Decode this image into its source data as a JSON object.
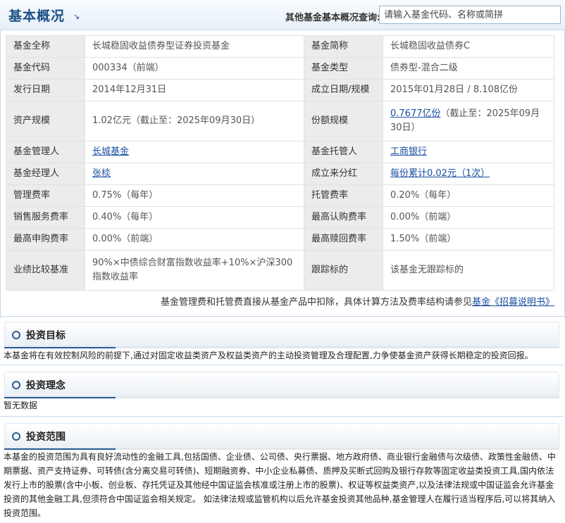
{
  "header": {
    "title": "基本概况",
    "title_arrow": "↘",
    "query_label": "其他基金基本概况查询:",
    "search_placeholder": "请输入基金代码、名称或简拼"
  },
  "info_rows": [
    {
      "label1": "基金全称",
      "value1": "长城稳固收益债券型证券投资基金",
      "label2": "基金简称",
      "value2": "长城稳固收益债券C"
    },
    {
      "label1": "基金代码",
      "value1": "000334（前端）",
      "label2": "基金类型",
      "value2": "债券型-混合二级"
    },
    {
      "label1": "发行日期",
      "value1": "2014年12月31日",
      "label2": "成立日期/规模",
      "value2": "2015年01月28日 / 8.108亿份"
    },
    {
      "label1": "资产规模",
      "value1": "1.02亿元（截止至：2025年09月30日）",
      "label2": "份额规模",
      "value2_link": "0.7677亿份",
      "value2_rest": "（截止至：2025年09月30日）"
    },
    {
      "label1": "基金管理人",
      "value1": "长城基金",
      "label2": "基金托管人",
      "value2": "工商银行"
    },
    {
      "label1": "基金经理人",
      "value1": "张棪",
      "label2": "成立来分红",
      "value2": "每份累计0.02元（1次）"
    },
    {
      "label1": "管理费率",
      "value1": "0.75%（每年）",
      "label2": "托管费率",
      "value2": "0.20%（每年）"
    },
    {
      "label1": "销售服务费率",
      "value1": "0.40%（每年）",
      "label2": "最高认购费率",
      "value2": "0.00%（前端）"
    },
    {
      "label1": "最高申购费率",
      "value1": "0.00%（前端）",
      "label2": "最高赎回费率",
      "value2": "1.50%（前端）"
    },
    {
      "label1": "业绩比较基准",
      "value1": "90%×中债综合财富指数收益率+10%×沪深300指数收益率",
      "label2": "跟踪标的",
      "value2": "该基金无跟踪标的"
    }
  ],
  "fee_note": {
    "text": "基金管理费和托管费直接从基金产品中扣除，具体计算方法及费率结构请参见",
    "link": "基金《招募说明书》"
  },
  "sections": {
    "objective": {
      "title": "投资目标",
      "body": "本基金将在有效控制风险的前提下,通过对固定收益类资产及权益类资产的主动投资管理及合理配置,力争使基金资产获得长期稳定的投资回报。"
    },
    "philosophy": {
      "title": "投资理念",
      "body": "暂无数据"
    },
    "scope": {
      "title": "投资范围",
      "body": "本基金的投资范围为具有良好流动性的金融工具,包括国债、企业债、公司债、央行票据、地方政府债、商业银行金融债与次级债、政策性金融债、中期票据、资产支持证券、可转债(含分离交易可转债)、短期融资券、中小企业私募债、质押及买断式回购及银行存款等固定收益类投资工具,国内依法发行上市的股票(含中小板、创业板、存托凭证及其他经中国证监会核准或注册上市的股票)、权证等权益类资产,以及法律法规或中国证监会允许基金投资的其他金融工具,但须符合中国证监会相关规定。 如法律法规或监管机构以后允许基金投资其他品种,基金管理人在履行适当程序后,可以将其纳入投资范围。"
    }
  }
}
